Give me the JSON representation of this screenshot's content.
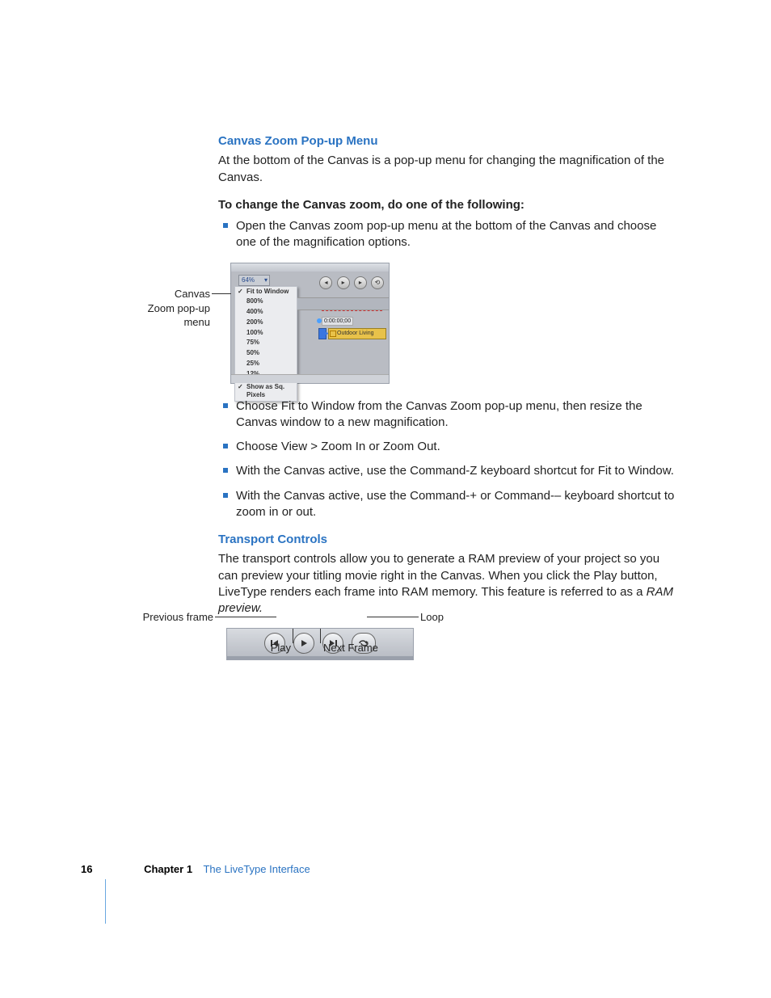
{
  "sections": {
    "canvasZoom": {
      "heading": "Canvas Zoom Pop-up Menu",
      "intro": "At the bottom of the Canvas is a pop-up menu for changing the magnification of the Canvas.",
      "instruction": "To change the Canvas zoom, do one of the following:",
      "bullet1": "Open the Canvas zoom pop-up menu at the bottom of the Canvas and choose one of the magnification options.",
      "bullets_after": [
        "Choose Fit to Window from the Canvas Zoom pop-up menu, then resize the Canvas window to a new magnification.",
        "Choose View > Zoom In or Zoom Out.",
        "With the Canvas active, use the Command-Z keyboard shortcut for Fit to Window.",
        "With the Canvas active, use the Command-+ or Command-– keyboard shortcut to zoom in or out."
      ]
    },
    "transport": {
      "heading": "Transport Controls",
      "body_pre": "The transport controls allow you to generate a RAM preview of your project so you can preview your titling movie right in the Canvas. When you click the Play button, LiveType renders each frame into RAM memory. This feature is referred to as a ",
      "body_italic": "RAM preview."
    }
  },
  "fig1": {
    "callout": "Canvas Zoom pop-up menu",
    "zoom_value": "64%",
    "menu_items": [
      "Fit to Window",
      "800%",
      "400%",
      "200%",
      "100%",
      "75%",
      "50%",
      "25%",
      "12%",
      "Show as Sq. Pixels"
    ],
    "timecode": "0:00:00;00",
    "clip_label": "Outdoor Living"
  },
  "fig2": {
    "labels": {
      "prev": "Previous frame",
      "play": "Play",
      "next": "Next Frame",
      "loop": "Loop"
    }
  },
  "footer": {
    "page": "16",
    "chapter": "Chapter 1",
    "title": "The LiveType Interface"
  }
}
